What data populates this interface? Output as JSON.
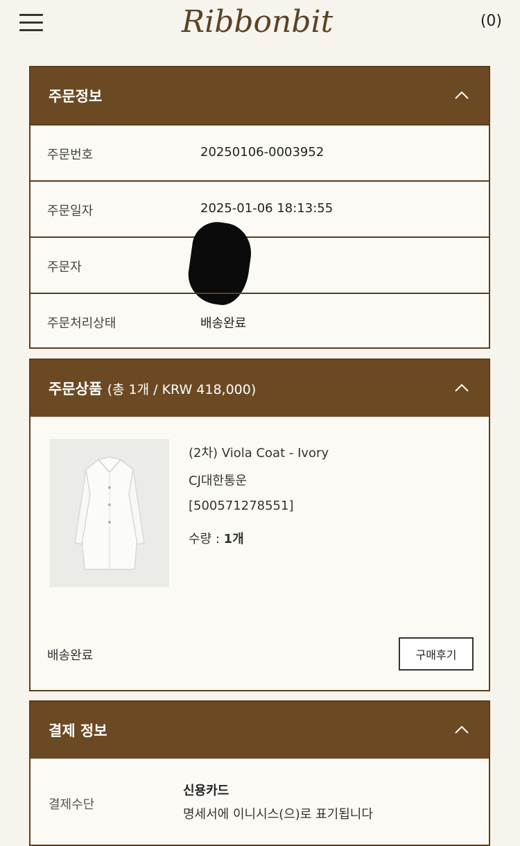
{
  "header": {
    "logo_text": "Ribbonbit",
    "cart_count": "(0)"
  },
  "order_info": {
    "title": "주문정보",
    "rows": [
      {
        "label": "주문번호",
        "value": "20250106-0003952"
      },
      {
        "label": "주문일자",
        "value": "2025-01-06 18:13:55"
      },
      {
        "label": "주문자",
        "value": ""
      },
      {
        "label": "주문처리상태",
        "value": "배송완료"
      }
    ]
  },
  "order_products": {
    "title": "주문상품",
    "subtitle": "(총 1개 / KRW 418,000)",
    "item": {
      "name": "(2차) Viola Coat - Ivory",
      "courier": "CJ대한통운",
      "tracking": "[500571278551]",
      "qty_label": "수량 : ",
      "qty_value": "1개"
    },
    "status": "배송완료",
    "review_button": "구매후기"
  },
  "payment_info": {
    "title": "결제 정보",
    "label": "결제수단",
    "method": "신용카드",
    "note": "명세서에 이니시스(으)로 표기됩니다"
  },
  "colors": {
    "header_brown": "#6b4a23",
    "border_brown": "#5b3d1c",
    "page_bg": "#f6f4ec"
  }
}
